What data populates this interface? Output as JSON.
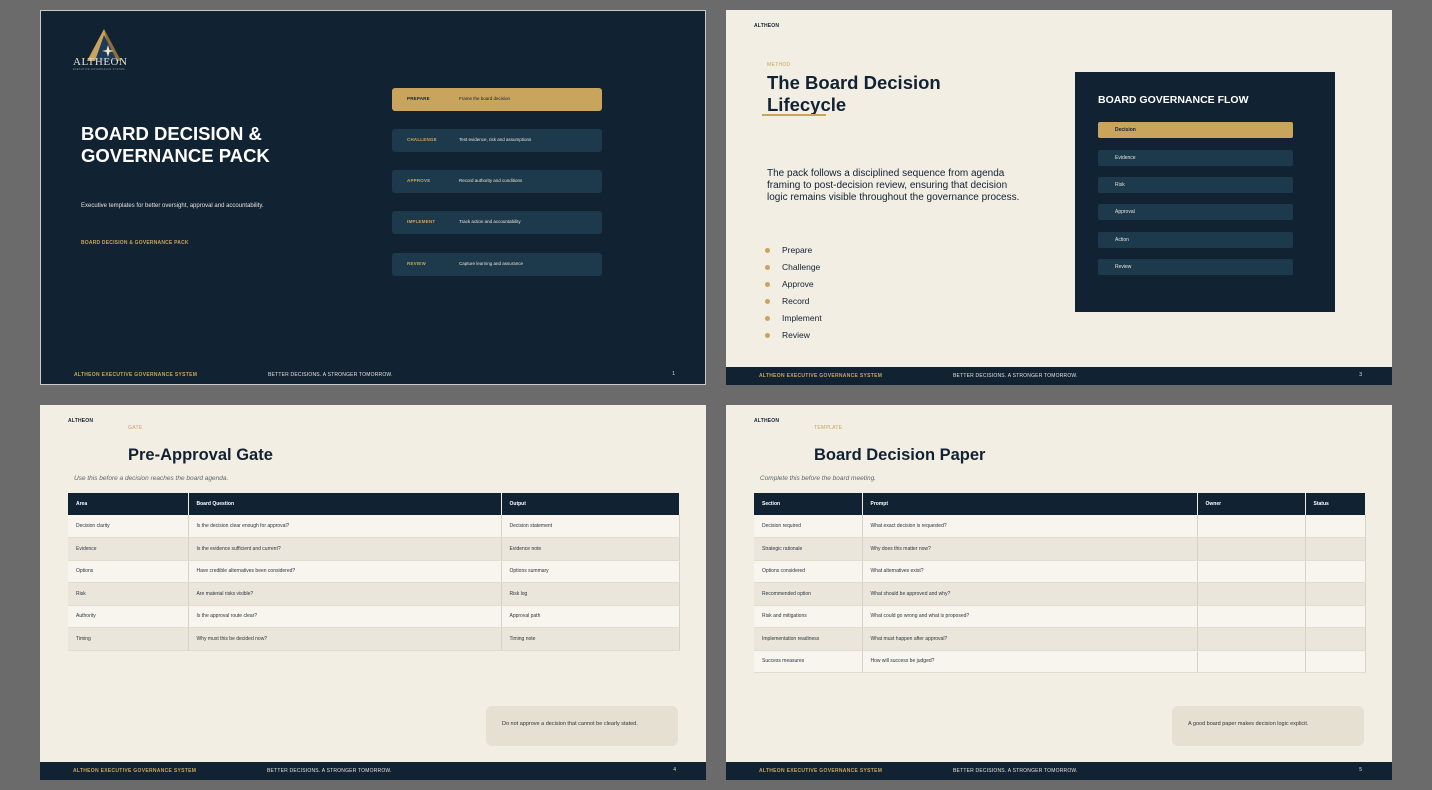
{
  "footer": {
    "brand": "ALTHEON EXECUTIVE GOVERNANCE SYSTEM",
    "tagline": "BETTER DECISIONS. A STRONGER TOMORROW."
  },
  "colors": {
    "navy": "#112233",
    "gold": "#c8a45c",
    "cream": "#f3eee4",
    "teal": "#1d3a4c"
  },
  "slide1": {
    "logo": {
      "name": "ALTHEON",
      "subtext": "EXECUTIVE GOVERNANCE SYSTEM",
      "icon": "mountain-star-logo"
    },
    "title": "BOARD DECISION & GOVERNANCE PACK",
    "subtitle": "Executive templates for better oversight, approval and accountability.",
    "pack_label": "BOARD DECISION & GOVERNANCE PACK",
    "page": "1",
    "steps": [
      {
        "label": "PREPARE",
        "desc": "Frame the board decision"
      },
      {
        "label": "CHALLENGE",
        "desc": "Test evidence, risk and assumptions"
      },
      {
        "label": "APPROVE",
        "desc": "Record authority and conditions"
      },
      {
        "label": "IMPLEMENT",
        "desc": "Track action and accountability"
      },
      {
        "label": "REVIEW",
        "desc": "Capture learning and assurance"
      }
    ]
  },
  "slide2": {
    "brand": "ALTHEON",
    "kicker": "METHOD",
    "title": "The Board Decision Lifecycle",
    "body": "The pack follows a disciplined sequence from agenda framing to post-decision review, ensuring that decision logic remains visible throughout the governance process.",
    "bullets": [
      "Prepare",
      "Challenge",
      "Approve",
      "Record",
      "Implement",
      "Review"
    ],
    "flow_title": "BOARD GOVERNANCE FLOW",
    "flow_items": [
      "Decision",
      "Evidence",
      "Risk",
      "Approval",
      "Action",
      "Review"
    ],
    "page": "3"
  },
  "slide3": {
    "brand": "ALTHEON",
    "kicker": "GATE",
    "title": "Pre-Approval Gate",
    "subtitle": "Use this before a decision reaches the board agenda.",
    "headers": [
      "Area",
      "Board Question",
      "Output"
    ],
    "rows": [
      [
        "Decision clarity",
        "Is the decision clear enough for approval?",
        "Decision statement"
      ],
      [
        "Evidence",
        "Is the evidence sufficient and current?",
        "Evidence note"
      ],
      [
        "Options",
        "Have credible alternatives been considered?",
        "Options summary"
      ],
      [
        "Risk",
        "Are material risks visible?",
        "Risk log"
      ],
      [
        "Authority",
        "Is the approval route clear?",
        "Approval path"
      ],
      [
        "Timing",
        "Why must this be decided now?",
        "Timing note"
      ]
    ],
    "callout": "Do not approve a decision that cannot be clearly stated.",
    "page": "4"
  },
  "slide4": {
    "brand": "ALTHEON",
    "kicker": "TEMPLATE",
    "title": "Board Decision Paper",
    "subtitle": "Complete this before the board meeting.",
    "headers": [
      "Section",
      "Prompt",
      "Owner",
      "Status"
    ],
    "rows": [
      [
        "Decision required",
        "What exact decision is requested?",
        "",
        ""
      ],
      [
        "Strategic rationale",
        "Why does this matter now?",
        "",
        ""
      ],
      [
        "Options considered",
        "What alternatives exist?",
        "",
        ""
      ],
      [
        "Recommended option",
        "What should be approved and why?",
        "",
        ""
      ],
      [
        "Risk and mitigations",
        "What could go wrong and what is proposed?",
        "",
        ""
      ],
      [
        "Implementation readiness",
        "What must happen after approval?",
        "",
        ""
      ],
      [
        "Success measures",
        "How will success be judged?",
        "",
        ""
      ]
    ],
    "callout": "A good board paper makes decision logic explicit.",
    "page": "5"
  }
}
